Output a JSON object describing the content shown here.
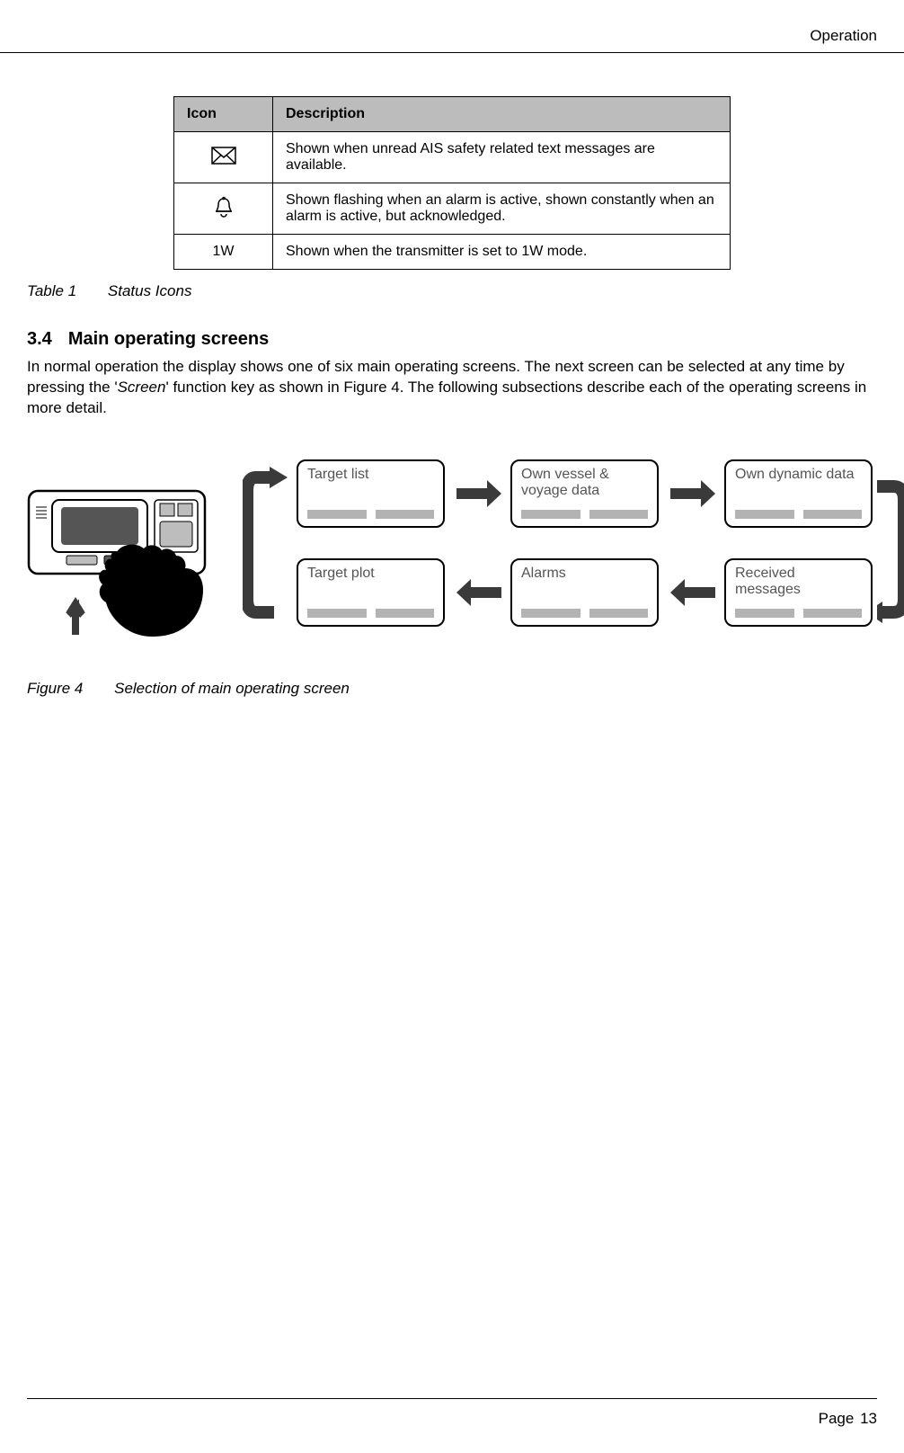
{
  "header": {
    "section_name": "Operation"
  },
  "table": {
    "col1": "Icon",
    "col2": "Description",
    "rows": [
      {
        "icon": "envelope",
        "icon_text": "",
        "desc": "Shown when unread AIS safety related text messages are available."
      },
      {
        "icon": "bell",
        "icon_text": "",
        "desc": "Shown flashing when an alarm is active, shown constantly when an alarm is active, but acknowledged."
      },
      {
        "icon": "text",
        "icon_text": "1W",
        "desc": "Shown when the transmitter is set to 1W mode."
      }
    ],
    "caption_prefix": "Table 1",
    "caption_text": "Status Icons"
  },
  "section": {
    "number": "3.4",
    "title": "Main operating screens",
    "para_a": "In normal operation the display shows one of six main operating screens. The next screen can be selected at any time by pressing the '",
    "para_italic": "Screen",
    "para_b": "' function key as shown in Figure 4. The following subsections describe each of the operating screens in more detail."
  },
  "diagram": {
    "cards": {
      "target_list": "Target list",
      "own_vessel": "Own vessel & voyage data",
      "own_dynamic": "Own dynamic data",
      "target_plot": "Target plot",
      "alarms": "Alarms",
      "received": "Received messages"
    },
    "caption_prefix": "Figure 4",
    "caption_text": "Selection of main operating screen"
  },
  "footer": {
    "page_label": "Page",
    "page_num": "13"
  }
}
